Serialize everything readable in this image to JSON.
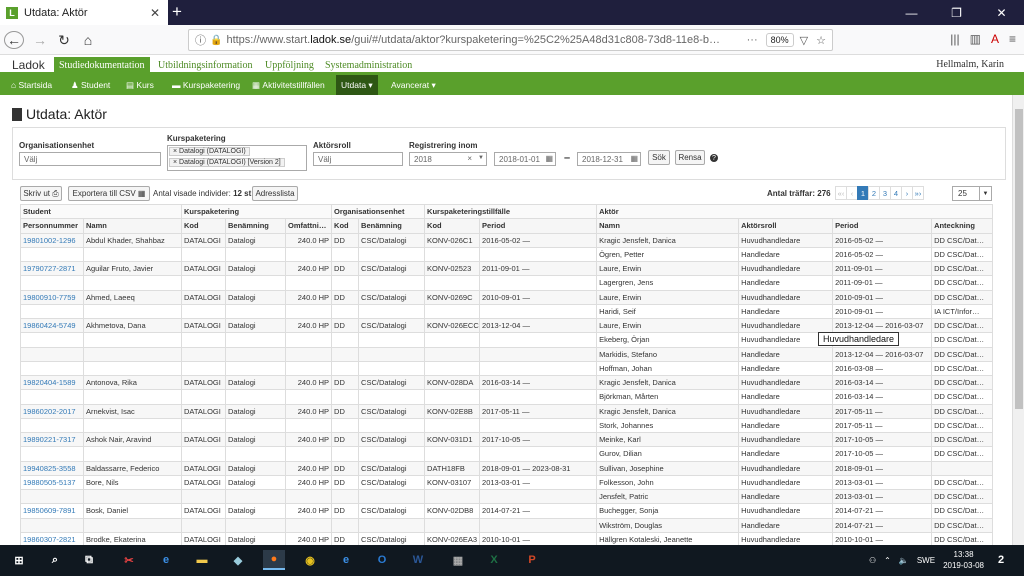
{
  "browser": {
    "tab_title": "Utdata: Aktör",
    "tab_logo": "L",
    "url_host": "https://www.start.",
    "url_domain": "ladok.se",
    "url_rest": "/gui/#/utdata/aktor?kurspaketering=%25C2%25A48d31c808-73d8-11e8-b…",
    "zoom": "80%"
  },
  "app": {
    "brand": "Ladok",
    "tabs": [
      "Studiedokumentation",
      "Utbildningsinformation",
      "Uppföljning",
      "Systemadministration"
    ],
    "user": "Hellmalm, Karin",
    "menu": [
      "Startsida",
      "Student",
      "Kurs",
      "Kurspaketering",
      "Aktivitetstillfällen",
      "Utdata ▾",
      "Avancerat ▾"
    ]
  },
  "page": {
    "title": "Utdata: Aktör"
  },
  "filters": {
    "org_label": "Organisationsenhet",
    "org_placeholder": "Välj",
    "kp_label": "Kurspaketering",
    "kp_tags": [
      "Datalogi (DATALOGI)",
      "Datalogi (DATALOGI) [Version 2]"
    ],
    "role_label": "Aktörsroll",
    "role_placeholder": "Välj",
    "reg_label": "Registrering inom",
    "reg_year": "2018",
    "date_from": "2018-01-01",
    "date_to": "2018-12-31",
    "search_btn": "Sök",
    "clear_btn": "Rensa",
    "dash": "–"
  },
  "toolbar": {
    "print_btn": "Skriv ut",
    "export_btn": "Exportera till CSV",
    "shown_label": "Antal visade individer:",
    "shown_count": "12 st",
    "address_btn": "Adresslista",
    "hits_label": "Antal träffar:",
    "hits_count": "276",
    "pages": [
      "«‹",
      "‹",
      "1",
      "2",
      "3",
      "4",
      "›",
      "»›"
    ],
    "per_page": "25"
  },
  "table": {
    "groups": [
      "Student",
      "Kurspaketering",
      "Organisationsenhet",
      "Kurspaketeringstillfälle",
      "Aktör"
    ],
    "headers": [
      "Personnummer",
      "Namn",
      "Kod",
      "Benämning",
      "Omfattni…",
      "Kod",
      "Benämning",
      "Kod",
      "Period",
      "Namn",
      "Aktörsroll",
      "Period",
      "Anteckning"
    ],
    "rows": [
      [
        "19801002-1296",
        "Abdul Khader, Shahbaz",
        "DATALOGI",
        "Datalogi",
        "240.0 HP",
        "DD",
        "CSC/Datalogi",
        "KONV-026C1",
        "2016-05-02 —",
        "Kragic Jensfelt, Danica",
        "Huvudhandledare",
        "2016-05-02 —",
        "DD CSC/Dat…"
      ],
      [
        "",
        "",
        "",
        "",
        "",
        "",
        "",
        "",
        "",
        "Ögren, Petter",
        "Handledare",
        "2016-05-02 —",
        "DD CSC/Dat…"
      ],
      [
        "19790727-2871",
        "Aguilar Fruto, Javier",
        "DATALOGI",
        "Datalogi",
        "240.0 HP",
        "DD",
        "CSC/Datalogi",
        "KONV-02523",
        "2011-09-01 —",
        "Laure, Erwin",
        "Huvudhandledare",
        "2011-09-01 —",
        "DD CSC/Dat…"
      ],
      [
        "",
        "",
        "",
        "",
        "",
        "",
        "",
        "",
        "",
        "Lagergren, Jens",
        "Handledare",
        "2011-09-01 —",
        "DD CSC/Dat…"
      ],
      [
        "19800910-7759",
        "Ahmed, Laeeq",
        "DATALOGI",
        "Datalogi",
        "240.0 HP",
        "DD",
        "CSC/Datalogi",
        "KONV-0269C",
        "2010-09-01 —",
        "Laure, Erwin",
        "Huvudhandledare",
        "2010-09-01 —",
        "DD CSC/Dat…"
      ],
      [
        "",
        "",
        "",
        "",
        "",
        "",
        "",
        "",
        "",
        "Haridi, Seif",
        "Handledare",
        "2010-09-01 —",
        "IA ICT/Infor…"
      ],
      [
        "19860424-5749",
        "Akhmetova, Dana",
        "DATALOGI",
        "Datalogi",
        "240.0 HP",
        "DD",
        "CSC/Datalogi",
        "KONV-026ECC",
        "2013-12-04 —",
        "Laure, Erwin",
        "Huvudhandledare",
        "2013-12-04 — 2016-03-07",
        "DD CSC/Dat…"
      ],
      [
        "",
        "",
        "",
        "",
        "",
        "",
        "",
        "",
        "",
        "Ekeberg, Örjan",
        "Huvudhandledare",
        "2016-03-08 —",
        "DD CSC/Dat…"
      ],
      [
        "",
        "",
        "",
        "",
        "",
        "",
        "",
        "",
        "",
        "Markidis, Stefano",
        "Handledare",
        "2013-12-04 — 2016-03-07",
        "DD CSC/Dat…"
      ],
      [
        "",
        "",
        "",
        "",
        "",
        "",
        "",
        "",
        "",
        "Hoffman, Johan",
        "Handledare",
        "2016-03-08 —",
        "DD CSC/Dat…"
      ],
      [
        "19820404-1589",
        "Antonova, Rika",
        "DATALOGI",
        "Datalogi",
        "240.0 HP",
        "DD",
        "CSC/Datalogi",
        "KONV-028DA",
        "2016-03-14 —",
        "Kragic Jensfelt, Danica",
        "Huvudhandledare",
        "2016-03-14 —",
        "DD CSC/Dat…"
      ],
      [
        "",
        "",
        "",
        "",
        "",
        "",
        "",
        "",
        "",
        "Björkman, Mårten",
        "Handledare",
        "2016-03-14 —",
        "DD CSC/Dat…"
      ],
      [
        "19860202-2017",
        "Arnekvist, Isac",
        "DATALOGI",
        "Datalogi",
        "240.0 HP",
        "DD",
        "CSC/Datalogi",
        "KONV-02E8B",
        "2017-05-11 —",
        "Kragic Jensfelt, Danica",
        "Huvudhandledare",
        "2017-05-11 —",
        "DD CSC/Dat…"
      ],
      [
        "",
        "",
        "",
        "",
        "",
        "",
        "",
        "",
        "",
        "Stork, Johannes",
        "Handledare",
        "2017-05-11 —",
        "DD CSC/Dat…"
      ],
      [
        "19890221-7317",
        "Ashok Nair, Aravind",
        "DATALOGI",
        "Datalogi",
        "240.0 HP",
        "DD",
        "CSC/Datalogi",
        "KONV-031D1",
        "2017-10-05 —",
        "Meinke, Karl",
        "Huvudhandledare",
        "2017-10-05 —",
        "DD CSC/Dat…"
      ],
      [
        "",
        "",
        "",
        "",
        "",
        "",
        "",
        "",
        "",
        "Gurov, Dilian",
        "Handledare",
        "2017-10-05 —",
        "DD CSC/Dat…"
      ],
      [
        "19940825-3558",
        "Baldassarre, Federico",
        "DATALOGI",
        "Datalogi",
        "240.0 HP",
        "DD",
        "CSC/Datalogi",
        "DATH18FB",
        "2018-09-01 — 2023-08-31",
        "Sullivan, Josephine",
        "Huvudhandledare",
        "2018-09-01 —",
        ""
      ],
      [
        "19880505-5137",
        "Bore, Nils",
        "DATALOGI",
        "Datalogi",
        "240.0 HP",
        "DD",
        "CSC/Datalogi",
        "KONV-03107",
        "2013-03-01 —",
        "Folkesson, John",
        "Huvudhandledare",
        "2013-03-01 —",
        "DD CSC/Dat…"
      ],
      [
        "",
        "",
        "",
        "",
        "",
        "",
        "",
        "",
        "",
        "Jensfelt, Patric",
        "Handledare",
        "2013-03-01 —",
        "DD CSC/Dat…"
      ],
      [
        "19850609-7891",
        "Bosk, Daniel",
        "DATALOGI",
        "Datalogi",
        "240.0 HP",
        "DD",
        "CSC/Datalogi",
        "KONV-02DB8",
        "2014-07-21 —",
        "Buchegger, Sonja",
        "Huvudhandledare",
        "2014-07-21 —",
        "DD CSC/Dat…"
      ],
      [
        "",
        "",
        "",
        "",
        "",
        "",
        "",
        "",
        "",
        "Wikström, Douglas",
        "Handledare",
        "2014-07-21 —",
        "DD CSC/Dat…"
      ],
      [
        "19860307-2821",
        "Brodke, Ekaterina",
        "DATALOGI",
        "Datalogi",
        "240.0 HP",
        "DD",
        "CSC/Datalogi",
        "KONV-026EA3",
        "2010-10-01 —",
        "Hällgren Kotaleski, Jeanette",
        "Huvudhandledare",
        "2010-10-01 —",
        "DD CSC/Dat…"
      ]
    ]
  },
  "tooltip": "Huvudhandledare",
  "taskbar": {
    "time": "13:38",
    "date": "2019-03-08",
    "lang": "SWE",
    "notifications": "2"
  }
}
